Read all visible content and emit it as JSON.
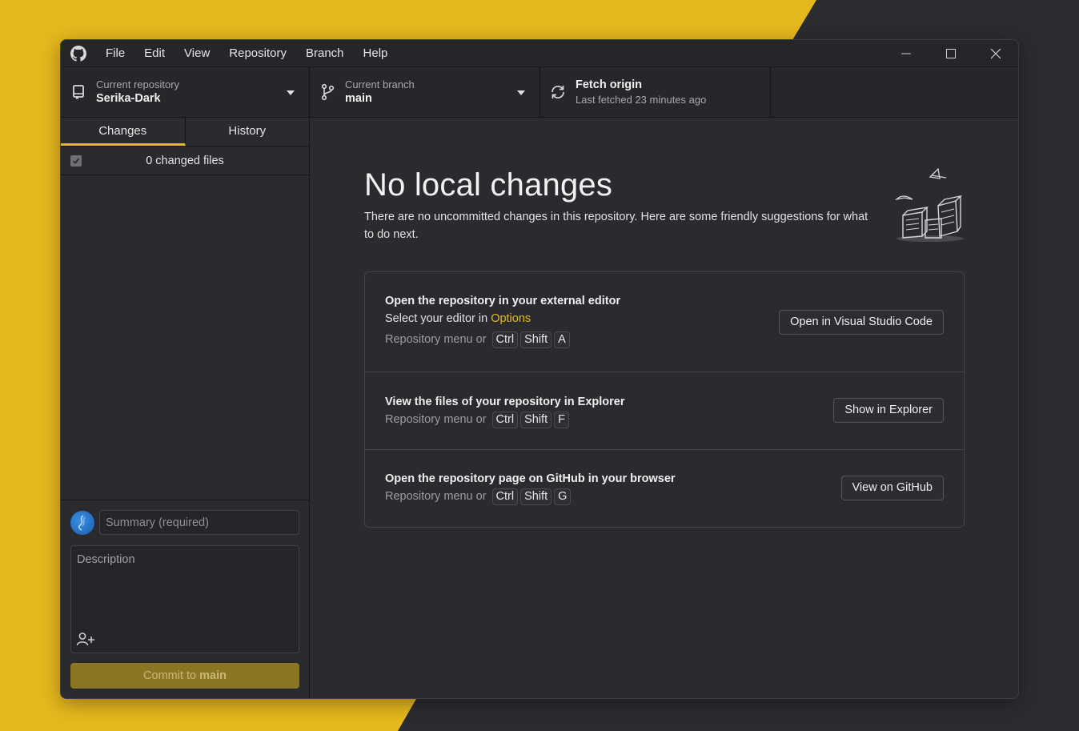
{
  "menu": [
    "File",
    "Edit",
    "View",
    "Repository",
    "Branch",
    "Help"
  ],
  "toolbar": {
    "repo_label": "Current repository",
    "repo_value": "Serika-Dark",
    "branch_label": "Current branch",
    "branch_value": "main",
    "fetch_title": "Fetch origin",
    "fetch_sub": "Last fetched 23 minutes ago"
  },
  "tabs": {
    "changes": "Changes",
    "history": "History"
  },
  "changes": {
    "count_label": "0 changed files"
  },
  "commit": {
    "summary_placeholder": "Summary (required)",
    "description_placeholder": "Description",
    "button_prefix": "Commit to ",
    "button_branch": "main"
  },
  "content": {
    "headline": "No local changes",
    "subtext": "There are no uncommitted changes in this repository. Here are some friendly suggestions for what to do next.",
    "cards": [
      {
        "title": "Open the repository in your external editor",
        "line_prefix": "Select your editor in ",
        "line_link": "Options",
        "shortcut_label": "Repository menu or",
        "keys": [
          "Ctrl",
          "Shift",
          "A"
        ],
        "button": "Open in Visual Studio Code"
      },
      {
        "title": "View the files of your repository in Explorer",
        "shortcut_label": "Repository menu or",
        "keys": [
          "Ctrl",
          "Shift",
          "F"
        ],
        "button": "Show in Explorer"
      },
      {
        "title": "Open the repository page on GitHub in your browser",
        "shortcut_label": "Repository menu or",
        "keys": [
          "Ctrl",
          "Shift",
          "G"
        ],
        "button": "View on GitHub"
      }
    ]
  },
  "colors": {
    "accent": "#e5b81e",
    "background": "#2a2b2e",
    "commit_button": "#8c7626"
  }
}
